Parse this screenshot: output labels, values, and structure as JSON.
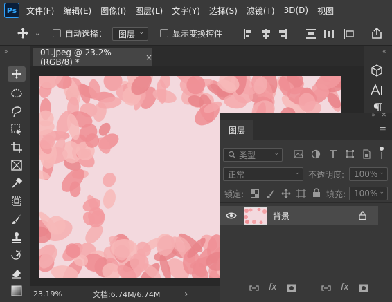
{
  "app": {
    "logo": "Ps"
  },
  "menu": [
    "文件(F)",
    "编辑(E)",
    "图像(I)",
    "图层(L)",
    "文字(Y)",
    "选择(S)",
    "滤镜(T)",
    "3D(D)",
    "视图"
  ],
  "options": {
    "auto_select_label": "自动选择：",
    "auto_select_target": "图层",
    "show_transform_label": "显示变换控件"
  },
  "document": {
    "tab_title": "01.jpeg @ 23.2%(RGB/8) *",
    "close_glyph": "×",
    "zoom": "23.19%",
    "doc_info": "文档:6.74M/6.74M",
    "status_arrow": "›"
  },
  "layers_panel": {
    "title": "图层",
    "filter_kind": "类型",
    "blend_mode": "正常",
    "opacity_label": "不透明度:",
    "opacity_value": "100%",
    "lock_label": "锁定:",
    "fill_label": "填充:",
    "fill_value": "100%",
    "layers": [
      {
        "name": "背景",
        "visible": true,
        "locked": true
      }
    ],
    "footer_fx": "fx"
  },
  "colors": {
    "accent": "#31a8ff",
    "panel_bg": "#383838",
    "photo_bg": "#f3d9de",
    "petal": "#f29a9f"
  }
}
